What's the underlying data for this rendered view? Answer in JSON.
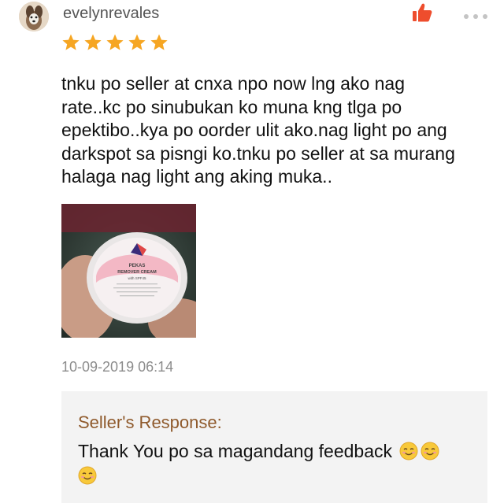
{
  "review": {
    "username": "evelynrevales",
    "rating": 5,
    "text": "tnku po seller at cnxa npo now lng ako nag rate..kc po sinubukan ko muna kng tlga po epektibo..kya po oorder ulit ako.nag light po ang darkspot sa pisngi ko.tnku po seller at sa murang halaga nag light ang aking muka..",
    "timestamp": "10-09-2019 06:14",
    "photo": {
      "product_line1": "PEKAS",
      "product_line2": "REMOVER CREAM",
      "product_line3": "with SPF45"
    }
  },
  "seller_response": {
    "title": "Seller's Response:",
    "text": "Thank You po sa magandang feedback"
  },
  "colors": {
    "star": "#f6a623",
    "like": "#ee4d2d",
    "response_title": "#8f5a2c",
    "response_bg": "#f3f3f3"
  },
  "icons": [
    "avatar",
    "like-icon",
    "more-options-icon",
    "star-icon",
    "smiling-face-emoji"
  ]
}
